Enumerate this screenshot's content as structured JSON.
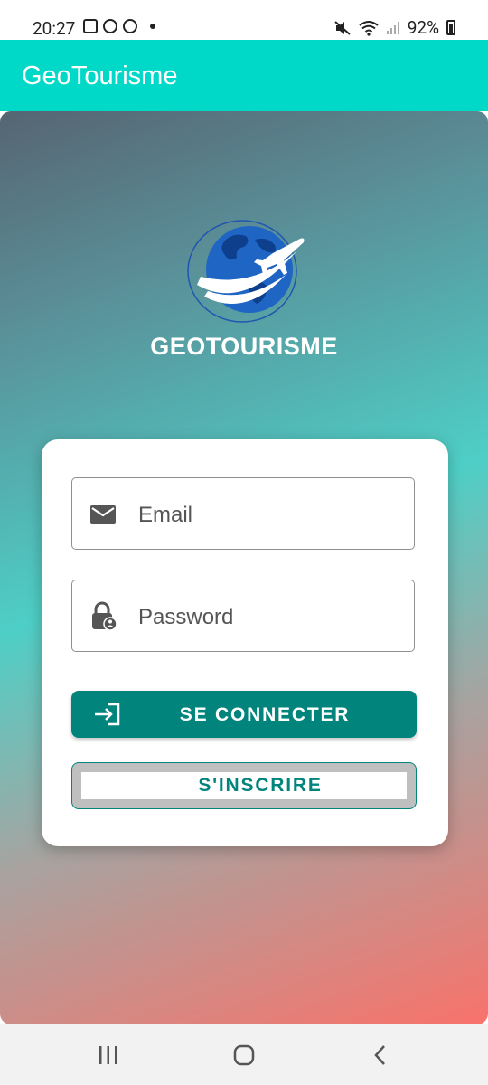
{
  "status_bar": {
    "time": "20:27",
    "battery": "92%"
  },
  "app_bar": {
    "title": "GeoTourisme",
    "background": "#00d9c8"
  },
  "logo": {
    "brand_text": "GEOTOURISME"
  },
  "login_form": {
    "email_placeholder": "Email",
    "password_placeholder": "Password",
    "login_button_label": "SE CONNECTER",
    "register_button_label": "S'INSCRIRE",
    "accent_color": "#00847c"
  },
  "icons": {
    "email": "mail-icon",
    "password": "lock-icon",
    "login": "login-icon",
    "nav_recents": "recents-icon",
    "nav_home": "home-icon",
    "nav_back": "back-icon"
  }
}
